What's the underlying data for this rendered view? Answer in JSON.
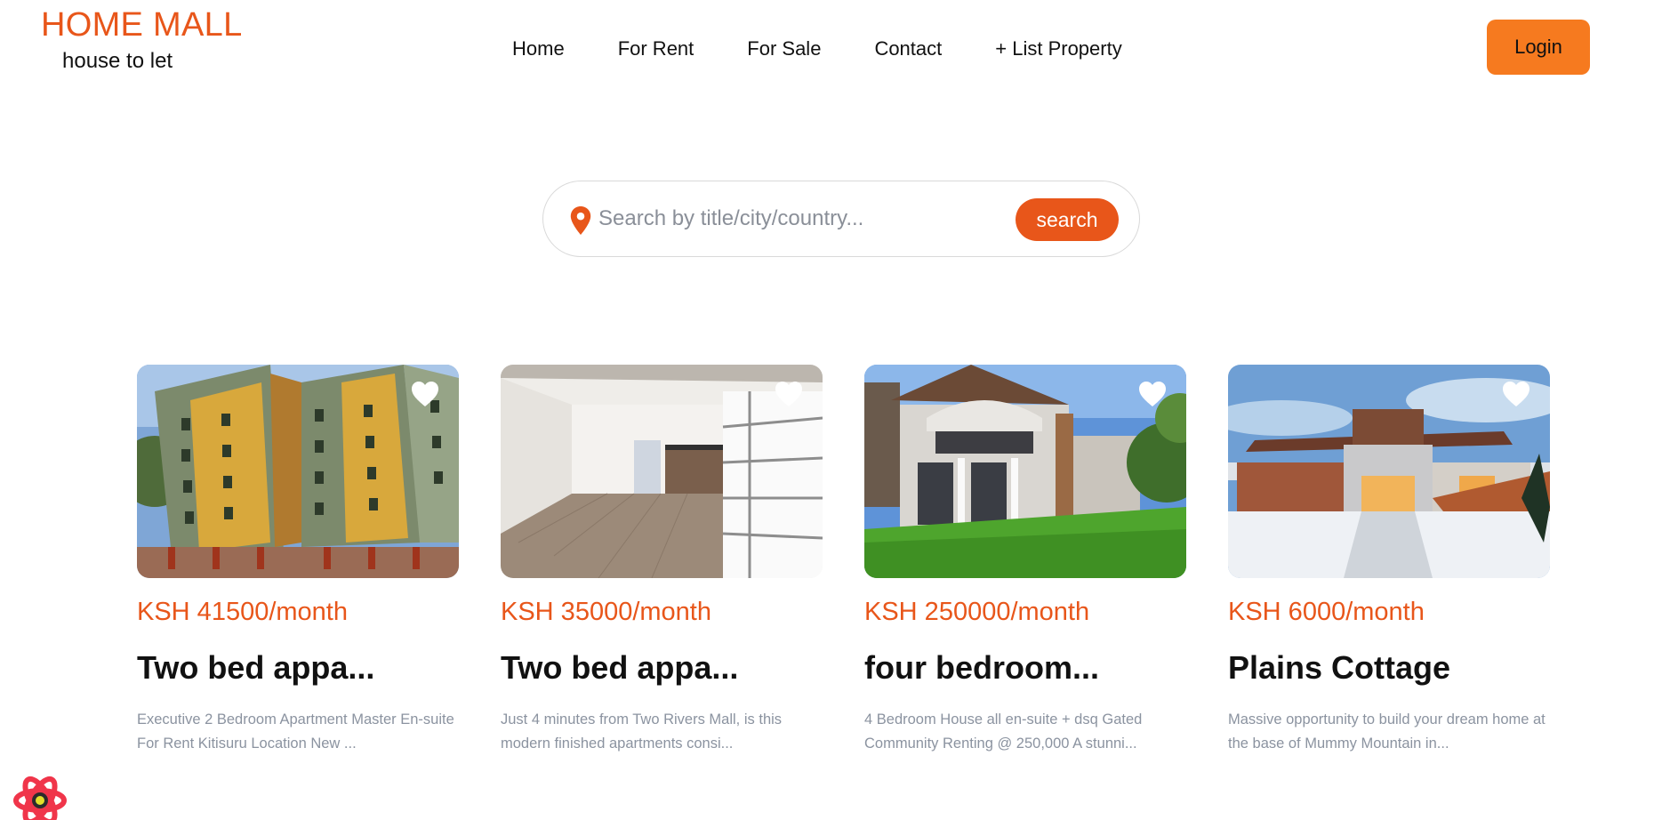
{
  "header": {
    "brand_title": "HOME MALL",
    "brand_subtitle": "house to let",
    "nav": [
      "Home",
      "For Rent",
      "For Sale",
      "Contact",
      "+ List Property"
    ],
    "login_label": "Login"
  },
  "search": {
    "placeholder": "Search by title/city/country...",
    "button_label": "search",
    "icon": "location-pin-icon"
  },
  "listings": [
    {
      "price": "KSH 41500/month",
      "title": "Two bed appa...",
      "description": "Executive 2 Bedroom Apartment Master En-suite For Rent Kitisuru Location New ...",
      "photo": "apartment-block-exterior"
    },
    {
      "price": "KSH 35000/month",
      "title": "Two bed appa...",
      "description": "Just 4 minutes from Two Rivers Mall, is this modern finished apartments consi...",
      "photo": "empty-apartment-interior"
    },
    {
      "price": "KSH 250000/month",
      "title": "four bedroom...",
      "description": "4 Bedroom House all en-suite + dsq Gated Community Renting @ 250,000 A stunni...",
      "photo": "villa-with-lawn"
    },
    {
      "price": "KSH 6000/month",
      "title": "Plains Cottage",
      "description": "Massive opportunity to build your dream home at the base of Mummy Mountain in...",
      "photo": "modern-house-in-snow"
    }
  ],
  "colors": {
    "brand": "#e8561a",
    "login_button": "#f67a1f",
    "muted_text": "#8b93a0"
  }
}
